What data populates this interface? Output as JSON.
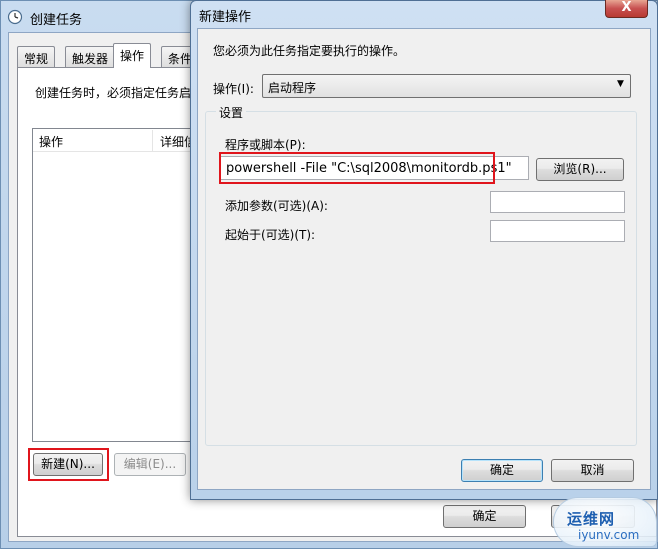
{
  "back_window": {
    "title": "创建任务",
    "tabs": [
      "常规",
      "触发器",
      "操作",
      "条件"
    ],
    "active_tab": 2,
    "description": "创建任务时，必须指定任务启",
    "list_headers": [
      "操作",
      "详细信"
    ],
    "new_button": "新建(N)...",
    "edit_button": "编辑(E)...",
    "ok_button": "确定",
    "cancel_button": "取消"
  },
  "dialog": {
    "title": "新建操作",
    "close_glyph": "X",
    "prompt": "您必须为此任务指定要执行的操作。",
    "action_label": "操作(I):",
    "action_value": "启动程序",
    "settings_legend": "设置",
    "program_label": "程序或脚本(P):",
    "program_value": "powershell -File \"C:\\sql2008\\monitordb.ps1\"",
    "browse_button": "浏览(R)...",
    "args_label": "添加参数(可选)(A):",
    "args_value": "",
    "start_label": "起始于(可选)(T):",
    "start_value": "",
    "ok_button": "确定",
    "cancel_button": "取消"
  },
  "watermark": {
    "line1": "运维网",
    "line2": "iyunv.com"
  },
  "colors": {
    "highlight_box": "#e0151c",
    "title_bar": "#b9d1ea",
    "close_button": "#c75050"
  }
}
